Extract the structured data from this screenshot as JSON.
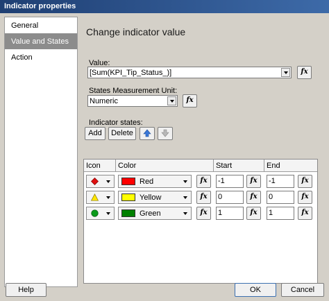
{
  "window": {
    "title": "Indicator properties"
  },
  "nav": {
    "items": [
      "General",
      "Value and States",
      "Action"
    ],
    "selected_index": 1
  },
  "main": {
    "heading": "Change indicator value",
    "value_label": "Value:",
    "value": "[Sum(KPI_Tip_Status_)]",
    "unit_label": "States Measurement Unit:",
    "unit": "Numeric",
    "states_label": "Indicator states:",
    "add_label": "Add",
    "delete_label": "Delete",
    "fx_label": "fx"
  },
  "grid": {
    "columns": [
      "Icon",
      "Color",
      "Start",
      "End"
    ],
    "rows": [
      {
        "icon": "red-diamond-icon",
        "color_name": "Red",
        "color_hex": "#ff0000",
        "start": "-1",
        "end": "-1"
      },
      {
        "icon": "yellow-triangle-icon",
        "color_name": "Yellow",
        "color_hex": "#ffff00",
        "start": "0",
        "end": "0"
      },
      {
        "icon": "green-circle-icon",
        "color_name": "Green",
        "color_hex": "#008000",
        "start": "1",
        "end": "1"
      }
    ]
  },
  "footer": {
    "help": "Help",
    "ok": "OK",
    "cancel": "Cancel"
  }
}
